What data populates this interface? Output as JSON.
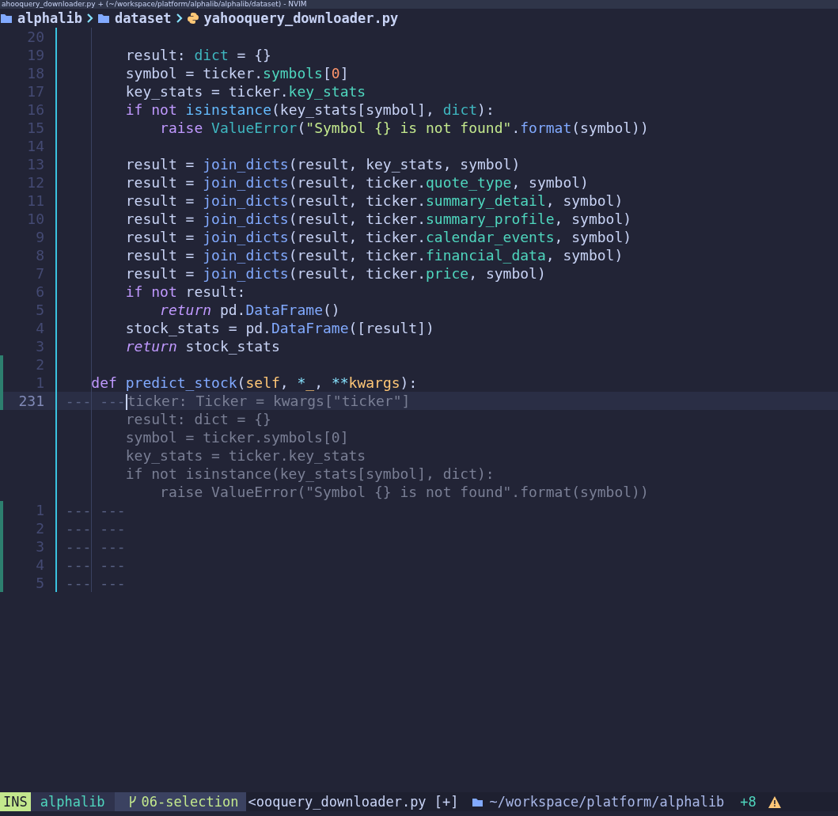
{
  "window": {
    "title": "ahooquery_downloader.py + (~/workspace/platform/alphalib/alphalib/dataset) - NVIM"
  },
  "breadcrumb": [
    {
      "kind": "folder",
      "label": "alphalib"
    },
    {
      "kind": "folder",
      "label": "dataset"
    },
    {
      "kind": "python",
      "label": "yahooquery_downloader.py"
    }
  ],
  "lines": [
    {
      "number": "20",
      "added": false,
      "current": false
    },
    {
      "number": "19",
      "added": false,
      "current": false,
      "tokens": [
        {
          "kind": "plain",
          "text": "        result: "
        },
        {
          "kind": "type",
          "text": "dict"
        },
        {
          "kind": "plain",
          "text": " = {}"
        }
      ]
    },
    {
      "number": "18",
      "added": false,
      "current": false,
      "tokens": [
        {
          "kind": "plain",
          "text": "        symbol = ticker."
        },
        {
          "kind": "attr",
          "text": "symbols"
        },
        {
          "kind": "plain",
          "text": "["
        },
        {
          "kind": "number",
          "text": "0"
        },
        {
          "kind": "plain",
          "text": "]"
        }
      ]
    },
    {
      "number": "17",
      "added": false,
      "current": false,
      "tokens": [
        {
          "kind": "plain",
          "text": "        key_stats = ticker."
        },
        {
          "kind": "attr",
          "text": "key_stats"
        }
      ]
    },
    {
      "number": "16",
      "added": false,
      "current": false,
      "tokens": [
        {
          "kind": "keyword",
          "text": "        if"
        },
        {
          "kind": "keyword",
          "text": " not"
        },
        {
          "kind": "builtin",
          "text": " isinstance"
        },
        {
          "kind": "plain",
          "text": "(key_stats[symbol], "
        },
        {
          "kind": "type",
          "text": "dict"
        },
        {
          "kind": "plain",
          "text": "):"
        }
      ]
    },
    {
      "number": "15",
      "added": false,
      "current": false,
      "tokens": [
        {
          "kind": "keyword",
          "text": "            raise"
        },
        {
          "kind": "type",
          "text": " ValueError"
        },
        {
          "kind": "plain",
          "text": "("
        },
        {
          "kind": "string",
          "text": "\"Symbol {} is not found\""
        },
        {
          "kind": "plain",
          "text": "."
        },
        {
          "kind": "func",
          "text": "format"
        },
        {
          "kind": "plain",
          "text": "(symbol))"
        }
      ]
    },
    {
      "number": "14",
      "added": false,
      "current": false
    },
    {
      "number": "13",
      "added": false,
      "current": false,
      "tokens": [
        {
          "kind": "plain",
          "text": "        result = "
        },
        {
          "kind": "func",
          "text": "join_dicts"
        },
        {
          "kind": "plain",
          "text": "(result, key_stats, symbol)"
        }
      ]
    },
    {
      "number": "12",
      "added": false,
      "current": false,
      "tokens": [
        {
          "kind": "plain",
          "text": "        result = "
        },
        {
          "kind": "func",
          "text": "join_dicts"
        },
        {
          "kind": "plain",
          "text": "(result, ticker."
        },
        {
          "kind": "attr",
          "text": "quote_type"
        },
        {
          "kind": "plain",
          "text": ", symbol)"
        }
      ]
    },
    {
      "number": "11",
      "added": false,
      "current": false,
      "tokens": [
        {
          "kind": "plain",
          "text": "        result = "
        },
        {
          "kind": "func",
          "text": "join_dicts"
        },
        {
          "kind": "plain",
          "text": "(result, ticker."
        },
        {
          "kind": "attr",
          "text": "summary_detail"
        },
        {
          "kind": "plain",
          "text": ", symbol)"
        }
      ]
    },
    {
      "number": "10",
      "added": false,
      "current": false,
      "tokens": [
        {
          "kind": "plain",
          "text": "        result = "
        },
        {
          "kind": "func",
          "text": "join_dicts"
        },
        {
          "kind": "plain",
          "text": "(result, ticker."
        },
        {
          "kind": "attr",
          "text": "summary_profile"
        },
        {
          "kind": "plain",
          "text": ", symbol)"
        }
      ]
    },
    {
      "number": "9",
      "added": false,
      "current": false,
      "tokens": [
        {
          "kind": "plain",
          "text": "        result = "
        },
        {
          "kind": "func",
          "text": "join_dicts"
        },
        {
          "kind": "plain",
          "text": "(result, ticker."
        },
        {
          "kind": "attr",
          "text": "calendar_events"
        },
        {
          "kind": "plain",
          "text": ", symbol)"
        }
      ]
    },
    {
      "number": "8",
      "added": false,
      "current": false,
      "tokens": [
        {
          "kind": "plain",
          "text": "        result = "
        },
        {
          "kind": "func",
          "text": "join_dicts"
        },
        {
          "kind": "plain",
          "text": "(result, ticker."
        },
        {
          "kind": "attr",
          "text": "financial_data"
        },
        {
          "kind": "plain",
          "text": ", symbol)"
        }
      ]
    },
    {
      "number": "7",
      "added": false,
      "current": false,
      "tokens": [
        {
          "kind": "plain",
          "text": "        result = "
        },
        {
          "kind": "func",
          "text": "join_dicts"
        },
        {
          "kind": "plain",
          "text": "(result, ticker."
        },
        {
          "kind": "attr",
          "text": "price"
        },
        {
          "kind": "plain",
          "text": ", symbol)"
        }
      ]
    },
    {
      "number": "6",
      "added": false,
      "current": false,
      "tokens": [
        {
          "kind": "keyword",
          "text": "        if"
        },
        {
          "kind": "keyword",
          "text": " not"
        },
        {
          "kind": "plain",
          "text": " result:"
        }
      ]
    },
    {
      "number": "5",
      "added": false,
      "current": false,
      "tokens": [
        {
          "kind": "keyword-italic",
          "text": "            return"
        },
        {
          "kind": "plain",
          "text": " pd."
        },
        {
          "kind": "func",
          "text": "DataFrame"
        },
        {
          "kind": "plain",
          "text": "()"
        }
      ]
    },
    {
      "number": "4",
      "added": false,
      "current": false,
      "tokens": [
        {
          "kind": "plain",
          "text": "        stock_stats = pd."
        },
        {
          "kind": "func",
          "text": "DataFrame"
        },
        {
          "kind": "plain",
          "text": "([result])"
        }
      ]
    },
    {
      "number": "3",
      "added": false,
      "current": false,
      "tokens": [
        {
          "kind": "keyword-italic",
          "text": "        return"
        },
        {
          "kind": "plain",
          "text": " stock_stats"
        }
      ]
    },
    {
      "number": "2",
      "added": true,
      "current": false
    },
    {
      "number": "1",
      "added": true,
      "current": false,
      "tokens": [
        {
          "kind": "keyword",
          "text": "    def"
        },
        {
          "kind": "func",
          "text": " predict_stock"
        },
        {
          "kind": "plain",
          "text": "("
        },
        {
          "kind": "param",
          "text": "self"
        },
        {
          "kind": "plain",
          "text": ", "
        },
        {
          "kind": "op",
          "text": "*"
        },
        {
          "kind": "param",
          "text": "_"
        },
        {
          "kind": "plain",
          "text": ", "
        },
        {
          "kind": "op",
          "text": "**"
        },
        {
          "kind": "param",
          "text": "kwargs"
        },
        {
          "kind": "plain",
          "text": "):"
        }
      ]
    },
    {
      "number": "231",
      "added": true,
      "current": true,
      "cursor": true,
      "tokens": [
        {
          "kind": "filler",
          "text": " --- ---"
        },
        {
          "kind": "ghost",
          "text": "ticker: Ticker = kwargs[\"ticker\"]"
        }
      ]
    },
    {
      "added": false,
      "current": false,
      "tokens": [
        {
          "kind": "ghost",
          "text": "        result: dict = {}"
        }
      ]
    },
    {
      "added": false,
      "current": false,
      "tokens": [
        {
          "kind": "ghost",
          "text": "        symbol = ticker.symbols[0]"
        }
      ]
    },
    {
      "added": false,
      "current": false,
      "tokens": [
        {
          "kind": "ghost",
          "text": "        key_stats = ticker.key_stats"
        }
      ]
    },
    {
      "added": false,
      "current": false,
      "tokens": [
        {
          "kind": "ghost",
          "text": "        if not isinstance(key_stats[symbol], dict):"
        }
      ]
    },
    {
      "added": false,
      "current": false,
      "tokens": [
        {
          "kind": "ghost",
          "text": "            raise ValueError(\"Symbol {} is not found\".format(symbol))"
        }
      ]
    },
    {
      "number": "1",
      "added": true,
      "current": false,
      "tokens": [
        {
          "kind": "filler",
          "text": " --- ---"
        }
      ]
    },
    {
      "number": "2",
      "added": true,
      "current": false,
      "tokens": [
        {
          "kind": "filler",
          "text": " --- ---"
        }
      ]
    },
    {
      "number": "3",
      "added": true,
      "current": false,
      "tokens": [
        {
          "kind": "filler",
          "text": " --- ---"
        }
      ]
    },
    {
      "number": "4",
      "added": true,
      "current": false,
      "tokens": [
        {
          "kind": "filler",
          "text": " --- ---"
        }
      ]
    },
    {
      "number": "5",
      "added": true,
      "current": false,
      "tokens": [
        {
          "kind": "filler",
          "text": " --- ---"
        }
      ]
    }
  ],
  "status_bar": {
    "mode": "INS",
    "project": "alphalib",
    "branch": "06-selection",
    "file": "<ooquery_downloader.py [+]",
    "path": "~/workspace/platform/alphalib",
    "diff_added": "+8"
  }
}
